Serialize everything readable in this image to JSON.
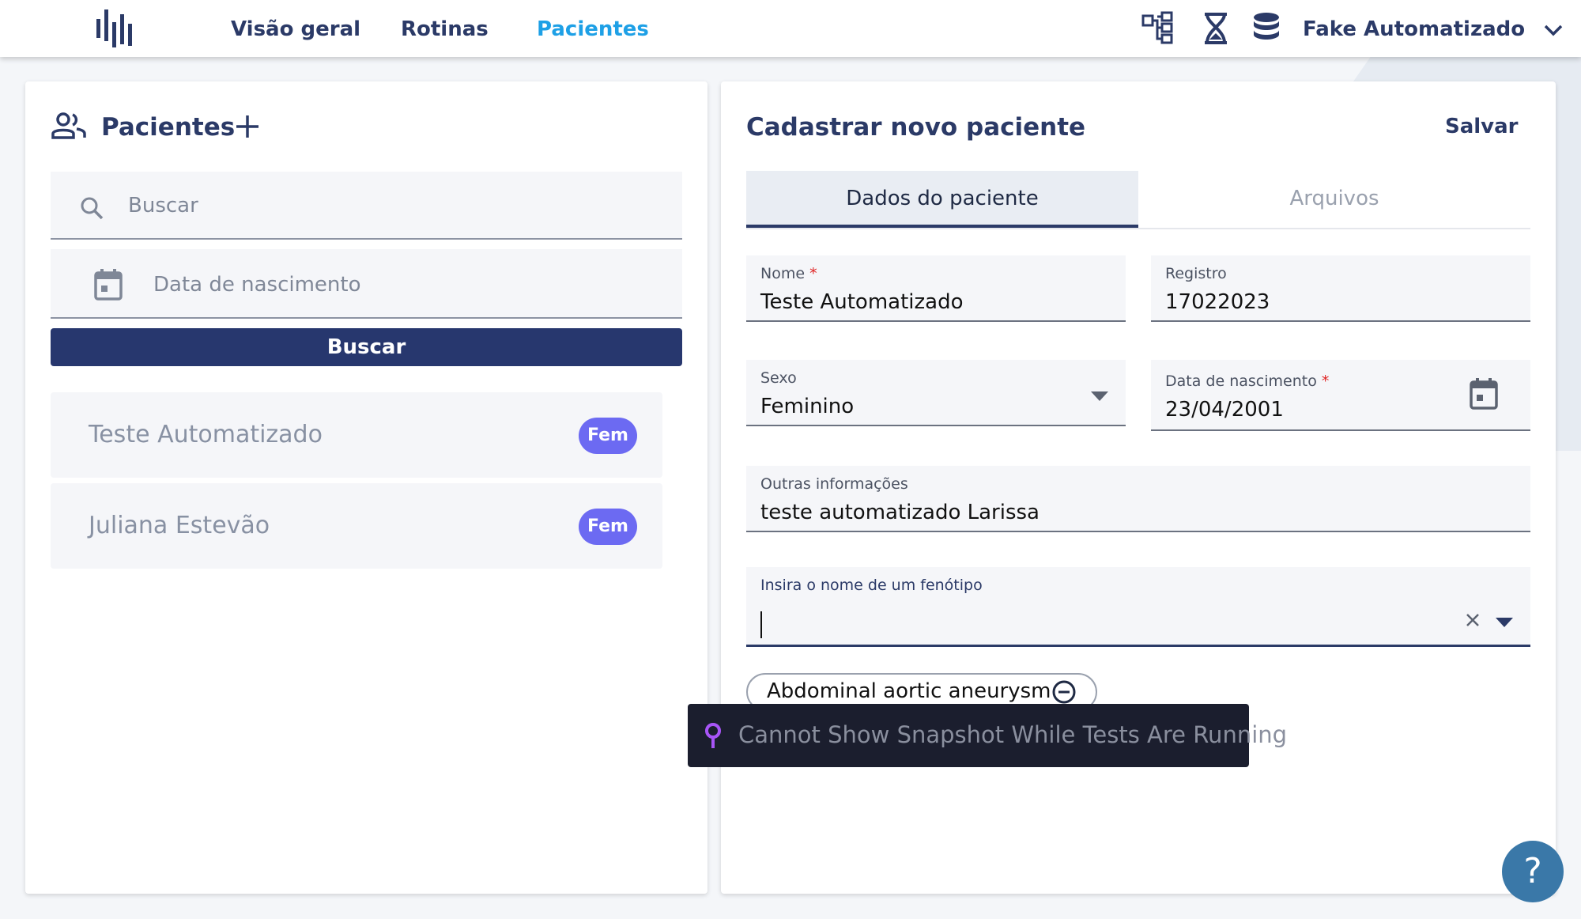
{
  "nav": {
    "items": [
      {
        "label": "Visão geral"
      },
      {
        "label": "Rotinas"
      },
      {
        "label": "Pacientes"
      }
    ],
    "active": "Pacientes",
    "user": "Fake Automatizado"
  },
  "patients_panel": {
    "title": "Pacientes",
    "search_placeholder": "Buscar",
    "birth_placeholder": "Data de nascimento",
    "search_button": "Buscar",
    "list": [
      {
        "name": "Teste Automatizado",
        "sex": "Fem"
      },
      {
        "name": "Juliana Estevão",
        "sex": "Fem"
      }
    ]
  },
  "form": {
    "title": "Cadastrar novo paciente",
    "save": "Salvar",
    "tabs": [
      {
        "label": "Dados do paciente"
      },
      {
        "label": "Arquivos"
      }
    ],
    "nome_label": "Nome",
    "nome_value": "Teste Automatizado",
    "registro_label": "Registro",
    "registro_value": "17022023",
    "sexo_label": "Sexo",
    "sexo_value": "Feminino",
    "nascimento_label": "Data de nascimento",
    "nascimento_value": "23/04/2001",
    "outras_label": "Outras informações",
    "outras_value": "teste automatizado Larissa",
    "fenotipo_label": "Insira o nome de um fenótipo",
    "fenotipo_value": "",
    "required_mark": "*",
    "chip_label": "Abdominal aortic aneurysm"
  },
  "toast": {
    "message": "Cannot Show Snapshot While Tests Are Running"
  },
  "help": "?",
  "colors": {
    "primary": "#27376e",
    "accent": "#1ea0e6",
    "badge": "#6c6af2"
  }
}
